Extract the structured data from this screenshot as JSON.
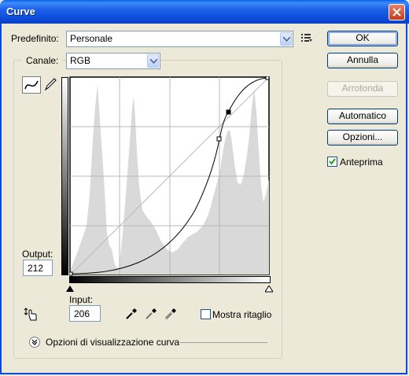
{
  "window": {
    "title": "Curve"
  },
  "preset": {
    "label": "Predefinito:",
    "value": "Personale"
  },
  "channel": {
    "label": "Canale:",
    "value": "RGB"
  },
  "buttons": {
    "ok": "OK",
    "cancel": "Annulla",
    "smooth": "Arrotonda",
    "auto": "Automatico",
    "options": "Opzioni..."
  },
  "preview": {
    "label": "Anteprima",
    "checked": true
  },
  "output": {
    "label": "Output:",
    "value": "212"
  },
  "input": {
    "label": "Input:",
    "value": "206"
  },
  "clipping": {
    "label": "Mostra ritaglio",
    "checked": false
  },
  "display_options": {
    "label": "Opzioni di visualizzazione curva"
  },
  "curve": {
    "mode": "curve-points",
    "points": [
      [
        0,
        0
      ],
      [
        190,
        180
      ],
      [
        206,
        212
      ],
      [
        255,
        255
      ]
    ],
    "selected_point": [
      206,
      212
    ]
  }
}
